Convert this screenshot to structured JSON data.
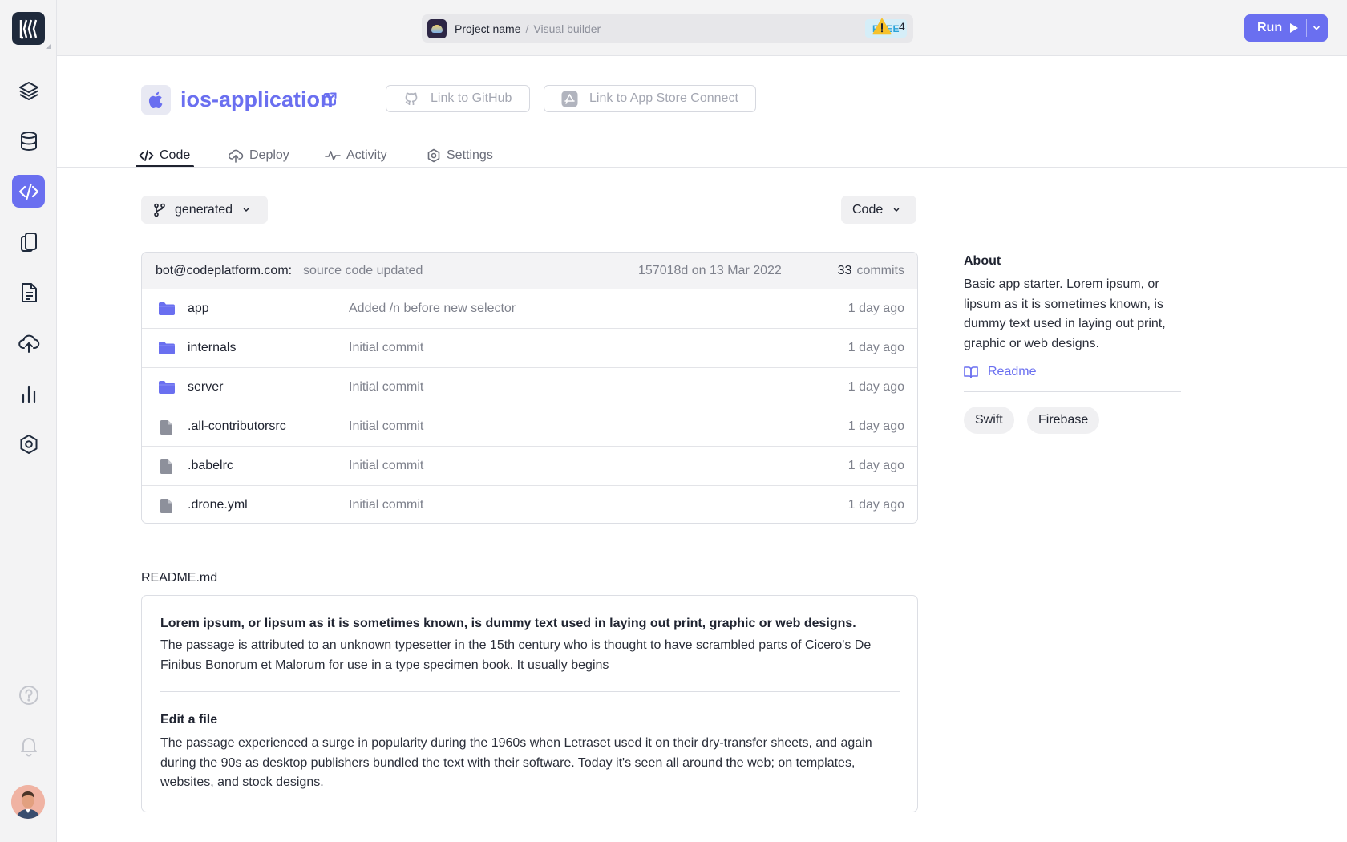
{
  "topbar": {
    "project_name": "Project name",
    "separator": "/",
    "project_sub": "Visual builder",
    "plan_badge": "FREE",
    "warning_count": "4",
    "run_label": "Run"
  },
  "header": {
    "app_name": "ios-application",
    "github_button": "Link to GitHub",
    "appstore_button": "Link to App Store Connect"
  },
  "tabs": [
    {
      "label": "Code"
    },
    {
      "label": "Deploy"
    },
    {
      "label": "Activity"
    },
    {
      "label": "Settings"
    }
  ],
  "branch": {
    "label": "generated"
  },
  "code_menu": {
    "label": "Code"
  },
  "commit": {
    "author": "bot@codeplatform.com:",
    "message": "source code updated",
    "hash_date": "157018d on 13 Mar 2022",
    "count": "33",
    "count_label": "commits"
  },
  "files": [
    {
      "name": "app",
      "type": "folder",
      "message": "Added /n before new selector",
      "time": "1 day ago"
    },
    {
      "name": "internals",
      "type": "folder",
      "message": "Initial commit",
      "time": "1 day ago"
    },
    {
      "name": "server",
      "type": "folder",
      "message": "Initial commit",
      "time": "1 day ago"
    },
    {
      "name": ".all-contributorsrc",
      "type": "file",
      "message": "Initial commit",
      "time": "1 day ago"
    },
    {
      "name": ".babelrc",
      "type": "file",
      "message": "Initial commit",
      "time": "1 day ago"
    },
    {
      "name": ".drone.yml",
      "type": "file",
      "message": "Initial commit",
      "time": "1 day ago"
    }
  ],
  "about": {
    "title": "About",
    "text": "Basic app starter. Lorem ipsum, or lipsum as it is sometimes known, is dummy text used in laying out print, graphic or web designs.",
    "readme_link": "Readme",
    "tags": [
      "Swift",
      "Firebase"
    ]
  },
  "readme": {
    "filename": "README.md",
    "bold_line": "Lorem ipsum, or lipsum as it is sometimes known, is dummy text used in laying out print, graphic or web designs.",
    "paragraph1": "The passage is attributed to an unknown typesetter in the 15th century who is thought to have scrambled parts of Cicero's De Finibus Bonorum et Malorum for use in a type specimen book. It usually begins",
    "heading": "Edit a file",
    "paragraph2": "The passage experienced a surge in popularity during the 1960s when Letraset used it on their dry-transfer sheets, and again during the 90s as desktop publishers bundled the text with their software. Today it's seen all around the web; on templates, websites, and stock designs."
  },
  "icons": {
    "sidebar": [
      "layers-icon",
      "database-icon",
      "code-icon",
      "devices-icon",
      "document-icon",
      "cloud-upload-icon",
      "analytics-icon",
      "settings-hexagon-icon",
      "help-icon",
      "bell-icon"
    ]
  },
  "colors": {
    "accent": "#6a6ff0",
    "dark": "#1f2a3c",
    "warning": "#f6c12b",
    "free_badge_bg": "#d5eef8",
    "free_badge_text": "#2aa3d8"
  }
}
